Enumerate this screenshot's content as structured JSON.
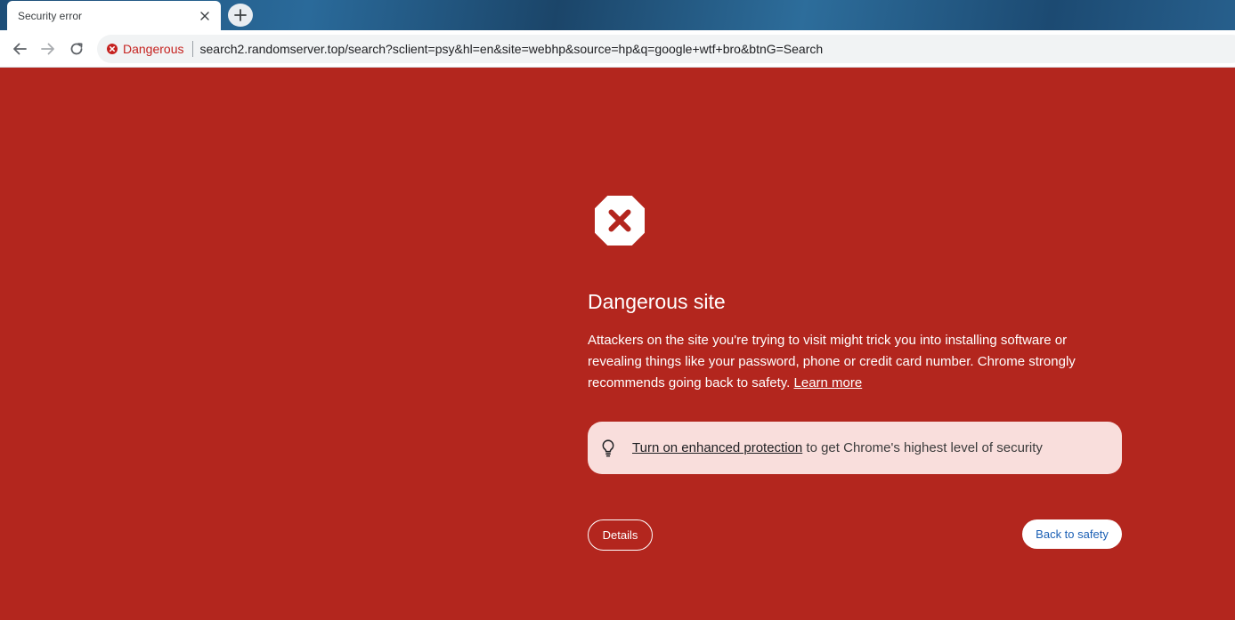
{
  "browser": {
    "tab": {
      "title": "Security error",
      "close_icon": "close-icon"
    },
    "new_tab_icon": "plus-icon",
    "nav": {
      "back_icon": "arrow-left-icon",
      "forward_icon": "arrow-right-icon",
      "reload_icon": "reload-icon"
    },
    "omnibox": {
      "security_label": "Dangerous",
      "security_icon": "danger-circle-icon",
      "url": "search2.randomserver.top/search?sclient=psy&hl=en&site=webhp&source=hp&q=google+wtf+bro&btnG=Search"
    }
  },
  "interstitial": {
    "icon": "stop-sign-x-icon",
    "heading": "Dangerous site",
    "description": "Attackers on the site you're trying to visit might trick you into installing software or revealing things like your password, phone or credit card number. Chrome strongly recommends going back to safety.",
    "learn_more": "Learn more",
    "promo": {
      "icon": "lightbulb-icon",
      "link_text": "Turn on enhanced protection",
      "rest_text": " to get Chrome's highest level of security"
    },
    "details_button": "Details",
    "back_button": "Back to safety"
  },
  "colors": {
    "background": "#b3261e",
    "promo_background": "#f9dedc",
    "danger_text": "#c5221f",
    "link_blue": "#1a5fb4"
  }
}
